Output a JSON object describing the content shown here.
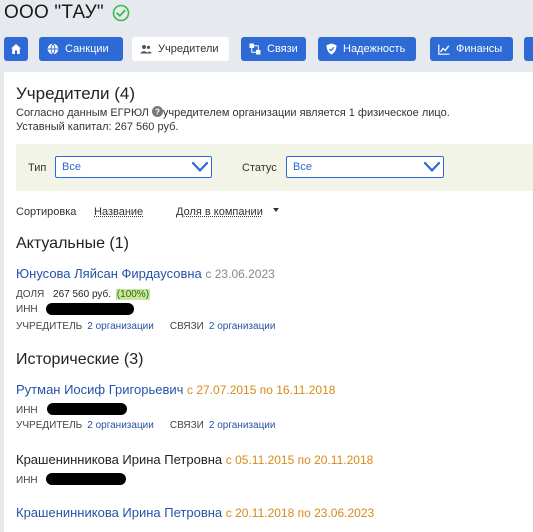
{
  "header": {
    "company_name": "ООО \"ТАУ\""
  },
  "toolbar": [
    {
      "label": "",
      "icon": "home-icon"
    },
    {
      "label": "Санкции",
      "icon": "globe-icon"
    },
    {
      "label": "Учредители",
      "icon": "people-icon",
      "active": true
    },
    {
      "label": "Связи",
      "icon": "links-icon"
    },
    {
      "label": "Надежность",
      "icon": "shield-icon"
    },
    {
      "label": "Финансы",
      "icon": "chart-icon"
    }
  ],
  "founders": {
    "title": "Учредители (4)",
    "note_part1": "Согласно данным ЕГРЮЛ",
    "note_part2": "учредителем организации является 1 физическое лицо.",
    "capital": "Уставный капитал: 267 560 руб."
  },
  "filters": {
    "type_label": "Тип",
    "type_value": "Все",
    "status_label": "Статус",
    "status_value": "Все"
  },
  "sort": {
    "label": "Сортировка",
    "by_name": "Название",
    "by_share": "Доля в компании"
  },
  "current": {
    "title": "Актуальные (1)",
    "person": {
      "name": "Юнусова Ляйсан Фирдаусовна",
      "since": "с 23.06.2023",
      "share_label": "ДОЛЯ",
      "share_value": "267 560 руб.",
      "share_percent": "(100%)",
      "inn_label": "ИНН",
      "founder_label": "УЧРЕДИТЕЛЬ",
      "founder_link": "2 организации",
      "links_label": "СВЯЗИ",
      "links_link": "2 организации"
    }
  },
  "historical": {
    "title": "Исторические (3)",
    "persons": [
      {
        "name": "Рутман Иосиф Григорьевич",
        "period": "с 27.07.2015 по 16.11.2018",
        "inn_label": "ИНН",
        "founder_label": "УЧРЕДИТЕЛЬ",
        "founder_link": "2 организации",
        "links_label": "СВЯЗИ",
        "links_link": "2 организации"
      },
      {
        "name": "Крашенинникова Ирина Петровна",
        "period": "с 05.11.2015 по 20.11.2018",
        "inn_label": "ИНН"
      },
      {
        "name": "Крашенинникова Ирина Петровна",
        "period": "с 20.11.2018 по 23.06.2023"
      }
    ]
  },
  "colors": {
    "accent": "#2d6ad6",
    "link": "#2653a6",
    "period": "#d9891a",
    "verified": "#3cb94a"
  }
}
